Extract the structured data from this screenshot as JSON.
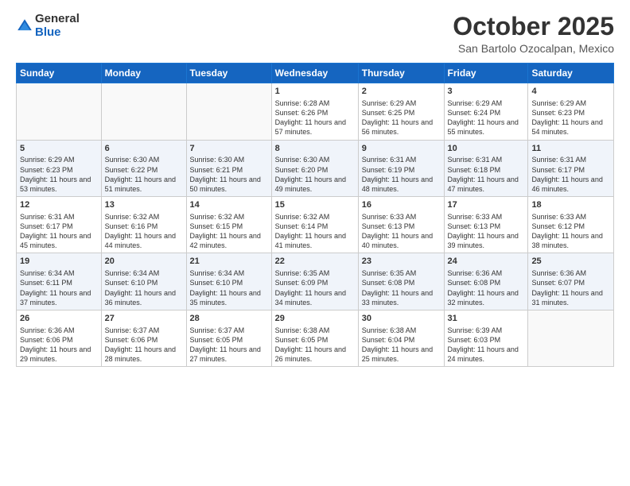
{
  "header": {
    "logo_general": "General",
    "logo_blue": "Blue",
    "month_title": "October 2025",
    "location": "San Bartolo Ozocalpan, Mexico"
  },
  "days_of_week": [
    "Sunday",
    "Monday",
    "Tuesday",
    "Wednesday",
    "Thursday",
    "Friday",
    "Saturday"
  ],
  "weeks": [
    [
      {
        "day": "",
        "info": ""
      },
      {
        "day": "",
        "info": ""
      },
      {
        "day": "",
        "info": ""
      },
      {
        "day": "1",
        "info": "Sunrise: 6:28 AM\nSunset: 6:26 PM\nDaylight: 11 hours and 57 minutes."
      },
      {
        "day": "2",
        "info": "Sunrise: 6:29 AM\nSunset: 6:25 PM\nDaylight: 11 hours and 56 minutes."
      },
      {
        "day": "3",
        "info": "Sunrise: 6:29 AM\nSunset: 6:24 PM\nDaylight: 11 hours and 55 minutes."
      },
      {
        "day": "4",
        "info": "Sunrise: 6:29 AM\nSunset: 6:23 PM\nDaylight: 11 hours and 54 minutes."
      }
    ],
    [
      {
        "day": "5",
        "info": "Sunrise: 6:29 AM\nSunset: 6:23 PM\nDaylight: 11 hours and 53 minutes."
      },
      {
        "day": "6",
        "info": "Sunrise: 6:30 AM\nSunset: 6:22 PM\nDaylight: 11 hours and 51 minutes."
      },
      {
        "day": "7",
        "info": "Sunrise: 6:30 AM\nSunset: 6:21 PM\nDaylight: 11 hours and 50 minutes."
      },
      {
        "day": "8",
        "info": "Sunrise: 6:30 AM\nSunset: 6:20 PM\nDaylight: 11 hours and 49 minutes."
      },
      {
        "day": "9",
        "info": "Sunrise: 6:31 AM\nSunset: 6:19 PM\nDaylight: 11 hours and 48 minutes."
      },
      {
        "day": "10",
        "info": "Sunrise: 6:31 AM\nSunset: 6:18 PM\nDaylight: 11 hours and 47 minutes."
      },
      {
        "day": "11",
        "info": "Sunrise: 6:31 AM\nSunset: 6:17 PM\nDaylight: 11 hours and 46 minutes."
      }
    ],
    [
      {
        "day": "12",
        "info": "Sunrise: 6:31 AM\nSunset: 6:17 PM\nDaylight: 11 hours and 45 minutes."
      },
      {
        "day": "13",
        "info": "Sunrise: 6:32 AM\nSunset: 6:16 PM\nDaylight: 11 hours and 44 minutes."
      },
      {
        "day": "14",
        "info": "Sunrise: 6:32 AM\nSunset: 6:15 PM\nDaylight: 11 hours and 42 minutes."
      },
      {
        "day": "15",
        "info": "Sunrise: 6:32 AM\nSunset: 6:14 PM\nDaylight: 11 hours and 41 minutes."
      },
      {
        "day": "16",
        "info": "Sunrise: 6:33 AM\nSunset: 6:13 PM\nDaylight: 11 hours and 40 minutes."
      },
      {
        "day": "17",
        "info": "Sunrise: 6:33 AM\nSunset: 6:13 PM\nDaylight: 11 hours and 39 minutes."
      },
      {
        "day": "18",
        "info": "Sunrise: 6:33 AM\nSunset: 6:12 PM\nDaylight: 11 hours and 38 minutes."
      }
    ],
    [
      {
        "day": "19",
        "info": "Sunrise: 6:34 AM\nSunset: 6:11 PM\nDaylight: 11 hours and 37 minutes."
      },
      {
        "day": "20",
        "info": "Sunrise: 6:34 AM\nSunset: 6:10 PM\nDaylight: 11 hours and 36 minutes."
      },
      {
        "day": "21",
        "info": "Sunrise: 6:34 AM\nSunset: 6:10 PM\nDaylight: 11 hours and 35 minutes."
      },
      {
        "day": "22",
        "info": "Sunrise: 6:35 AM\nSunset: 6:09 PM\nDaylight: 11 hours and 34 minutes."
      },
      {
        "day": "23",
        "info": "Sunrise: 6:35 AM\nSunset: 6:08 PM\nDaylight: 11 hours and 33 minutes."
      },
      {
        "day": "24",
        "info": "Sunrise: 6:36 AM\nSunset: 6:08 PM\nDaylight: 11 hours and 32 minutes."
      },
      {
        "day": "25",
        "info": "Sunrise: 6:36 AM\nSunset: 6:07 PM\nDaylight: 11 hours and 31 minutes."
      }
    ],
    [
      {
        "day": "26",
        "info": "Sunrise: 6:36 AM\nSunset: 6:06 PM\nDaylight: 11 hours and 29 minutes."
      },
      {
        "day": "27",
        "info": "Sunrise: 6:37 AM\nSunset: 6:06 PM\nDaylight: 11 hours and 28 minutes."
      },
      {
        "day": "28",
        "info": "Sunrise: 6:37 AM\nSunset: 6:05 PM\nDaylight: 11 hours and 27 minutes."
      },
      {
        "day": "29",
        "info": "Sunrise: 6:38 AM\nSunset: 6:05 PM\nDaylight: 11 hours and 26 minutes."
      },
      {
        "day": "30",
        "info": "Sunrise: 6:38 AM\nSunset: 6:04 PM\nDaylight: 11 hours and 25 minutes."
      },
      {
        "day": "31",
        "info": "Sunrise: 6:39 AM\nSunset: 6:03 PM\nDaylight: 11 hours and 24 minutes."
      },
      {
        "day": "",
        "info": ""
      }
    ]
  ]
}
